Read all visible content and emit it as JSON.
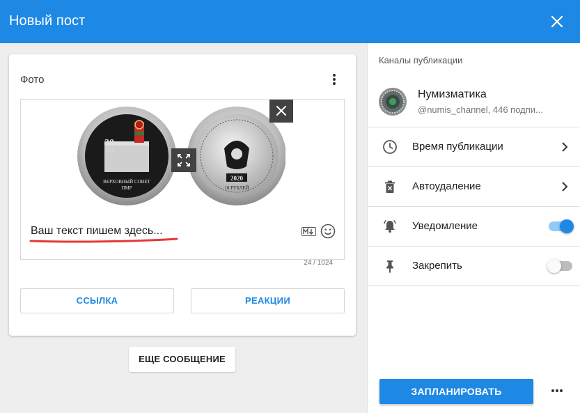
{
  "header": {
    "title": "Новый пост"
  },
  "post": {
    "section_title": "Фото",
    "placeholder_text": "Ваш текст пишем здесь...",
    "counter": "24 / 1024",
    "link_button": "ССЫЛКА",
    "reactions_button": "РЕАКЦИИ",
    "photo": {
      "coin_left": {
        "top_number": "30",
        "top_word": "ЛЕТ",
        "bottom_line1": "ВЕРХОВНЫЙ СОВЕТ",
        "bottom_line2": "ПМР"
      },
      "coin_right": {
        "year": "2020",
        "value": "10 РУБЛЕЙ"
      }
    }
  },
  "more_message_button": "ЕЩЕ СООБЩЕНИЕ",
  "sidebar": {
    "section_label": "Каналы публикации",
    "channel": {
      "name": "Нумизматика",
      "handle": "@numis_channel, 446 подпи..."
    },
    "options": [
      {
        "label": "Время публикации",
        "icon": "clock-icon"
      },
      {
        "label": "Автоудаление",
        "icon": "delete-timer-icon"
      },
      {
        "label": "Уведомление",
        "icon": "bell-icon",
        "enabled": true
      },
      {
        "label": "Закрепить",
        "icon": "pin-icon",
        "enabled": false
      }
    ],
    "schedule_button": "ЗАПЛАНИРОВАТЬ"
  },
  "colors": {
    "accent": "#1e88e5",
    "underline": "#e53935"
  }
}
